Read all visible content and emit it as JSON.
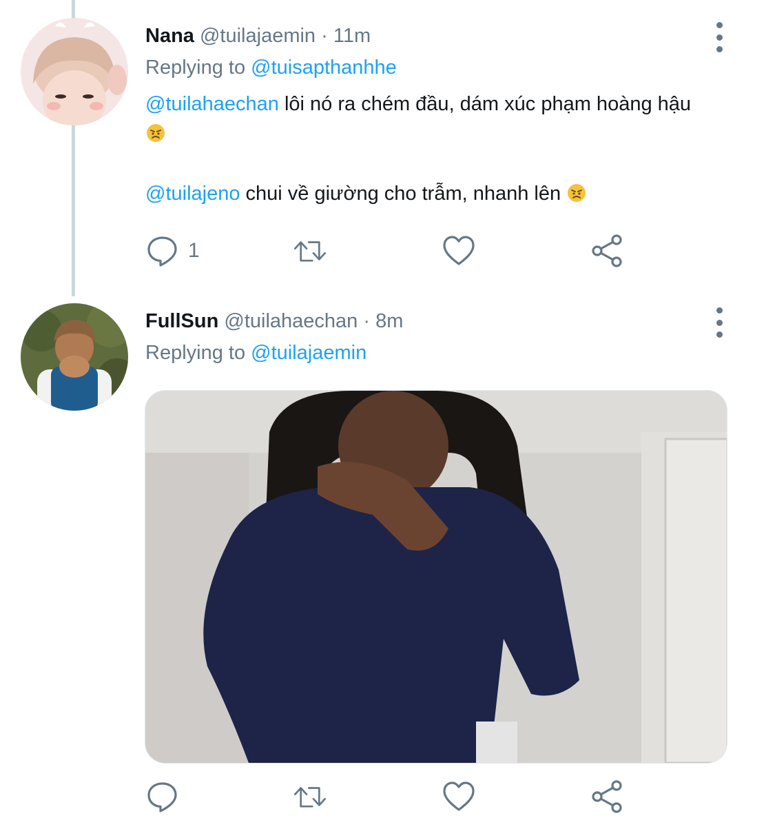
{
  "tweets": [
    {
      "display_name": "Nana",
      "handle": "@tuilajaemin",
      "time": "11m",
      "separator": "·",
      "replying_prefix": "Replying to",
      "replying_to": "@tuisapthanhhe",
      "line1_mention": "@tuilahaechan",
      "line1_text": " lôi nó ra chém đầu, dám xúc phạm hoàng hậu",
      "line2_mention": "@tuilajeno",
      "line2_text": " chui về giường cho trẫm, nhanh lên ",
      "reply_count": "1",
      "emoji": "angry-face"
    },
    {
      "display_name": "FullSun",
      "handle": "@tuilahaechan",
      "time": "8m",
      "separator": "·",
      "replying_prefix": "Replying to",
      "replying_to": "@tuilajaemin",
      "media": "photo"
    }
  ],
  "colors": {
    "link": "#1da1f2",
    "secondary": "#657786",
    "text": "#14171a",
    "thread_line": "#ccd6dd"
  }
}
